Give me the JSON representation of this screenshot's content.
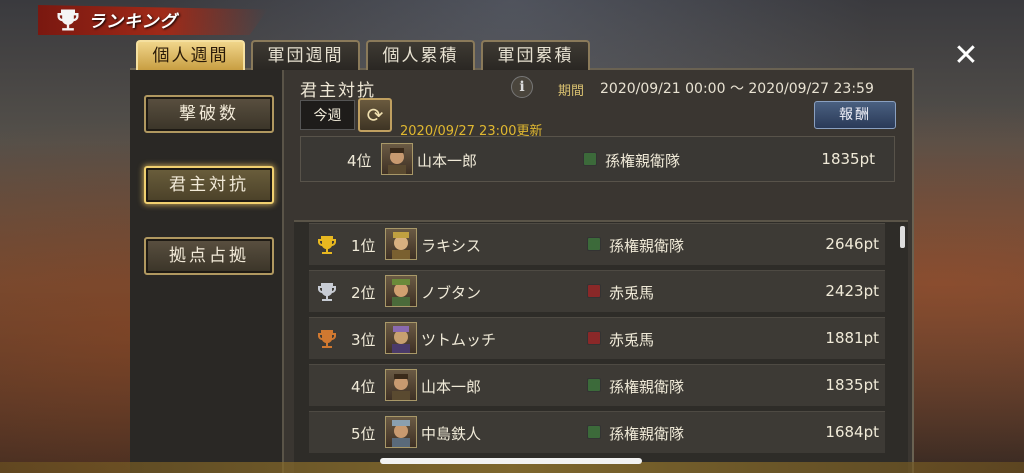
{
  "header": {
    "title": "ランキング"
  },
  "tabs": [
    "個人週間",
    "軍団週間",
    "個人累積",
    "軍団累積"
  ],
  "active_tab": 0,
  "categories": [
    "撃破数",
    "君主対抗",
    "拠点占拠"
  ],
  "active_category": 1,
  "section": {
    "title": "君主対抗",
    "info": "i",
    "period_label": "期間",
    "period": "2020/09/21 00:00 ～ 2020/09/27 23:59",
    "week_label": "今週",
    "refresh_icon": "⟳",
    "updated": "2020/09/27 23:00更新",
    "reward_label": "報酬"
  },
  "my_entry": {
    "rank": "4位",
    "name": "山本一郎",
    "guild": "孫権親衛隊",
    "guild_color": "green",
    "points": "1835pt"
  },
  "rankings": [
    {
      "rank": "1位",
      "trophy": "gold",
      "name": "ラキシス",
      "guild": "孫権親衛隊",
      "guild_color": "green",
      "points": "2646pt"
    },
    {
      "rank": "2位",
      "trophy": "silver",
      "name": "ノブタン",
      "guild": "赤兎馬",
      "guild_color": "red",
      "points": "2423pt"
    },
    {
      "rank": "3位",
      "trophy": "bronze",
      "name": "ツトムッチ",
      "guild": "赤兎馬",
      "guild_color": "red",
      "points": "1881pt"
    },
    {
      "rank": "4位",
      "trophy": "",
      "name": "山本一郎",
      "guild": "孫権親衛隊",
      "guild_color": "green",
      "points": "1835pt"
    },
    {
      "rank": "5位",
      "trophy": "",
      "name": "中島鉄人",
      "guild": "孫権親衛隊",
      "guild_color": "green",
      "points": "1684pt"
    }
  ],
  "colors": {
    "gold": "#e8b820",
    "silver": "#c8ccd4",
    "bronze": "#d07830",
    "accent": "#f0d070"
  },
  "close_icon": "✕"
}
